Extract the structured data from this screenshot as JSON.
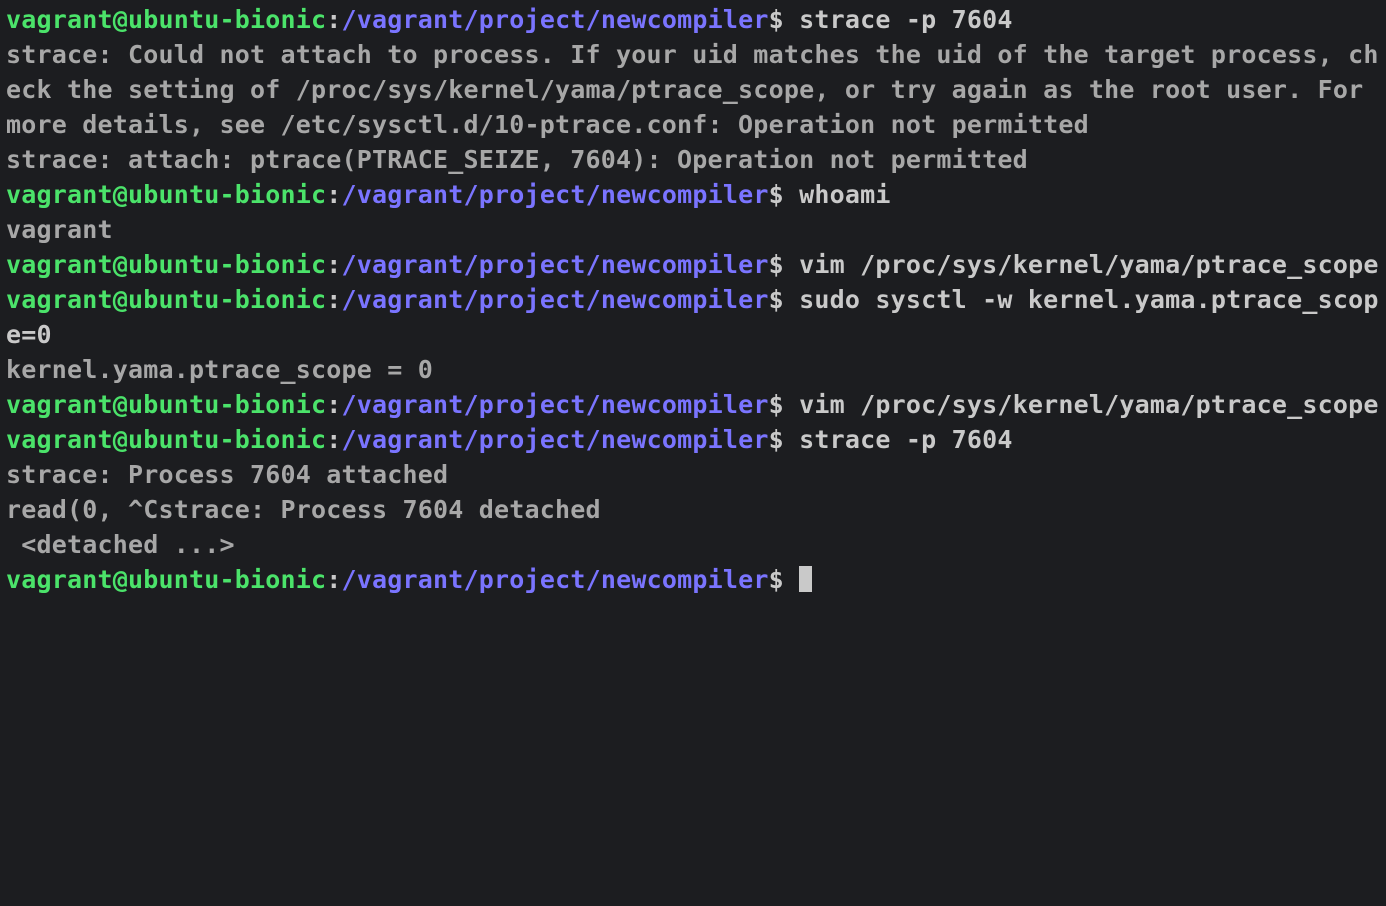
{
  "prompt": {
    "user": "vagrant@ubuntu-bionic",
    "sep": ":",
    "path": "/vagrant/project/newcompiler",
    "sym": "$"
  },
  "lines": [
    {
      "type": "prompt",
      "cmd": "strace -p 7604"
    },
    {
      "type": "out",
      "text": "strace: Could not attach to process. If your uid matches the uid of the target process, check the setting of /proc/sys/kernel/yama/ptrace_scope, or try again as the root user. For more details, see /etc/sysctl.d/10-ptrace.conf: Operation not permitted"
    },
    {
      "type": "out",
      "text": "strace: attach: ptrace(PTRACE_SEIZE, 7604): Operation not permitted"
    },
    {
      "type": "prompt",
      "cmd": "whoami"
    },
    {
      "type": "out",
      "text": "vagrant"
    },
    {
      "type": "prompt",
      "cmd": "vim /proc/sys/kernel/yama/ptrace_scope"
    },
    {
      "type": "prompt",
      "cmd": "sudo sysctl -w kernel.yama.ptrace_scope=0"
    },
    {
      "type": "out",
      "text": "kernel.yama.ptrace_scope = 0"
    },
    {
      "type": "prompt",
      "cmd": "vim /proc/sys/kernel/yama/ptrace_scope"
    },
    {
      "type": "prompt",
      "cmd": "strace -p 7604"
    },
    {
      "type": "out",
      "text": "strace: Process 7604 attached"
    },
    {
      "type": "out",
      "text": "read(0, ^Cstrace: Process 7604 detached"
    },
    {
      "type": "out",
      "text": " <detached ...>"
    },
    {
      "type": "prompt",
      "cmd": "",
      "cursor": true
    }
  ]
}
